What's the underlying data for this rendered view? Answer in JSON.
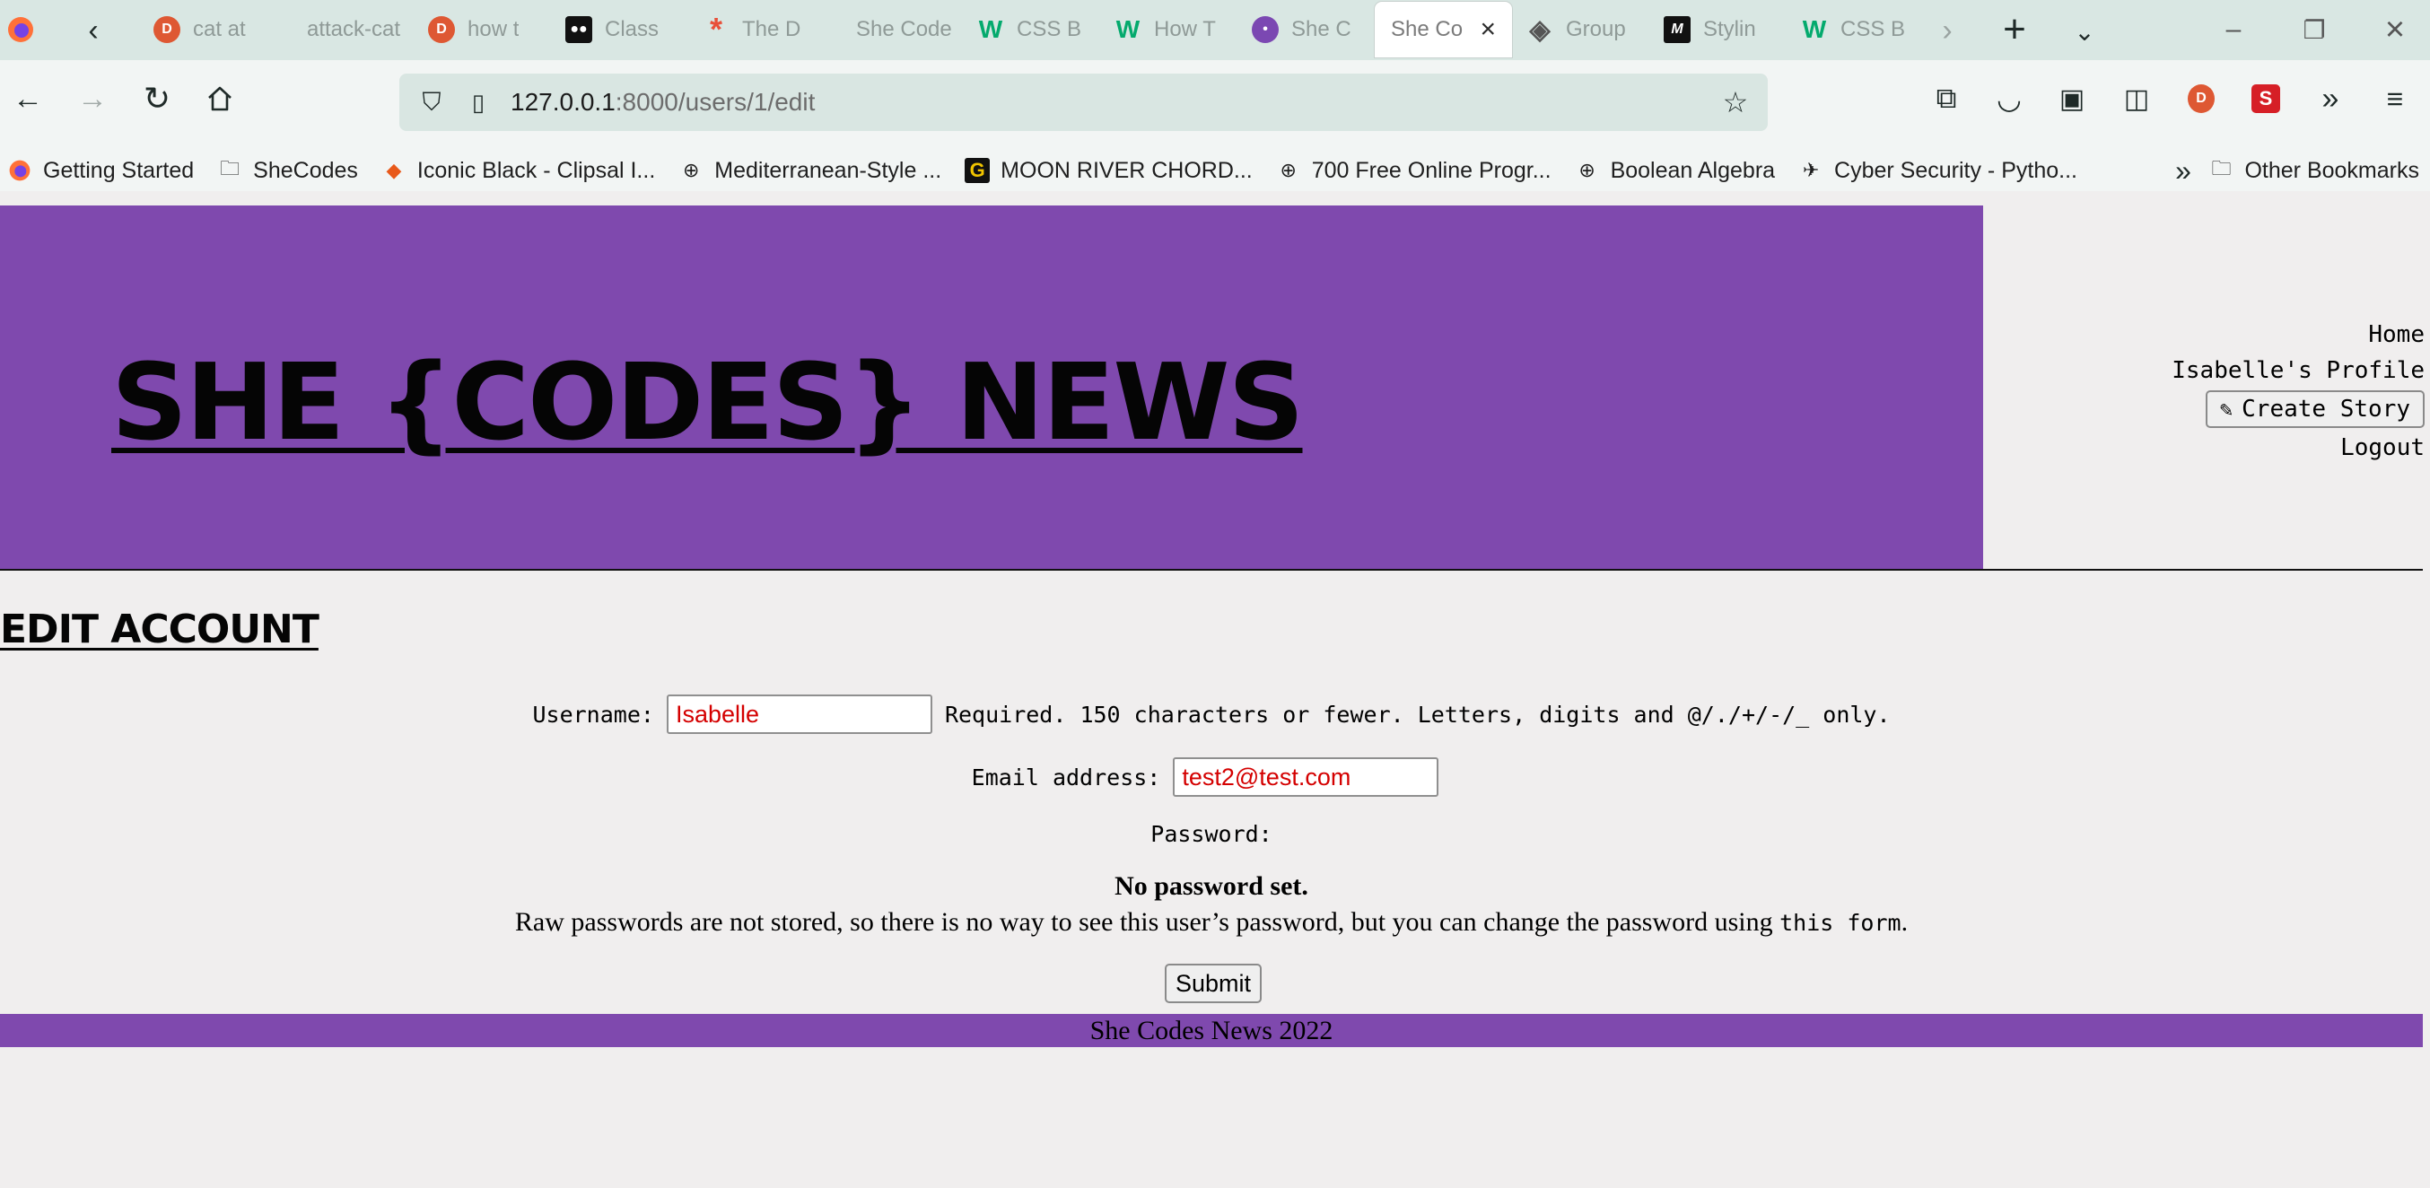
{
  "browser": {
    "tabs": [
      {
        "title": "cat at",
        "icon": "duckduckgo-icon",
        "active": false
      },
      {
        "title": "attack-cat",
        "icon": "",
        "active": false
      },
      {
        "title": "how t",
        "icon": "duckduckgo-icon",
        "active": false
      },
      {
        "title": "Class",
        "icon": "medium-icon",
        "active": false
      },
      {
        "title": "The D",
        "icon": "asterisk-icon",
        "active": false
      },
      {
        "title": "She Code",
        "icon": "",
        "active": false
      },
      {
        "title": "CSS B",
        "icon": "w3schools-icon",
        "active": false
      },
      {
        "title": "How T",
        "icon": "w3schools-icon",
        "active": false
      },
      {
        "title": "She C",
        "icon": "shecodes-icon",
        "active": false
      },
      {
        "title": "She Co",
        "icon": "",
        "active": true
      },
      {
        "title": "Group",
        "icon": "group-icon",
        "active": false
      },
      {
        "title": "Stylin",
        "icon": "m-icon",
        "active": false
      },
      {
        "title": "CSS B",
        "icon": "w3schools-icon",
        "active": false
      }
    ],
    "url_host": "127.0.0.1",
    "url_rest": ":8000/users/1/edit",
    "bookmarks": [
      {
        "label": "Getting Started",
        "icon": "firefox-icon"
      },
      {
        "label": "SheCodes",
        "icon": "folder-icon"
      },
      {
        "label": "Iconic Black - Clipsal I...",
        "icon": "clipsal-icon"
      },
      {
        "label": "Mediterranean-Style ...",
        "icon": "globe-icon"
      },
      {
        "label": "MOON RIVER CHORD...",
        "icon": "g-icon"
      },
      {
        "label": "700 Free Online Progr...",
        "icon": "globe-icon"
      },
      {
        "label": "Boolean Algebra",
        "icon": "globe-icon"
      },
      {
        "label": "Cyber Security - Pytho...",
        "icon": "cyber-icon"
      }
    ],
    "other_bookmarks": "Other Bookmarks"
  },
  "site": {
    "title": "SHE {CODES} NEWS",
    "nav": {
      "home": "Home",
      "profile": "Isabelle's Profile",
      "create_story": "Create Story",
      "logout": "Logout"
    },
    "footer": "She Codes News 2022"
  },
  "form": {
    "heading": "EDIT ACCOUNT",
    "username_label": "Username:",
    "username_value": "Isabelle",
    "username_help": "Required. 150 characters or fewer. Letters, digits and @/./+/-/_ only.",
    "email_label": "Email address:",
    "email_value": "test2@test.com",
    "password_label": "Password:",
    "password_status": "No password set.",
    "password_note": "Raw passwords are not stored, so there is no way to see this user’s password, but you can change the password using ",
    "password_link": "this form",
    "password_note_end": ".",
    "submit_label": "Submit"
  },
  "colors": {
    "brand_purple": "#7f49ae",
    "input_text": "#d40000"
  }
}
